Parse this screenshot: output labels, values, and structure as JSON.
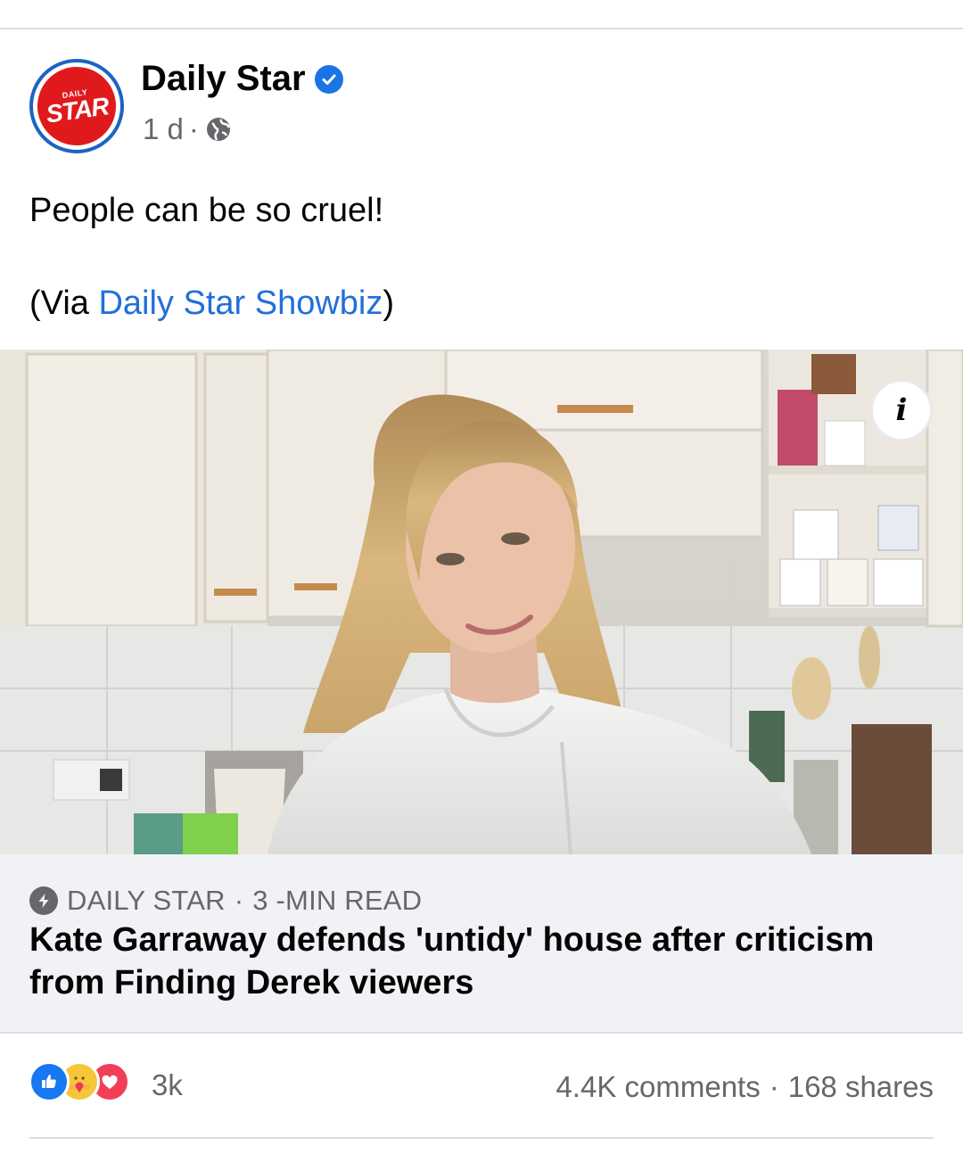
{
  "post": {
    "page_name": "Daily Star",
    "avatar_text_small": "DAILY",
    "avatar_text_big": "STAR",
    "time": "1 d",
    "separator": "·",
    "text_line1": "People can be so cruel!",
    "text_line2_prefix": "(Via ",
    "text_line2_link": "Daily Star Showbiz",
    "text_line2_suffix": ")"
  },
  "link_card": {
    "source": "DAILY STAR",
    "separator": "·",
    "read_time": "3 -MIN READ",
    "title": "Kate Garraway defends 'untidy' house after criticism from Finding Derek viewers",
    "info_label": "i"
  },
  "engagement": {
    "reaction_count": "3k",
    "comments": "4.4K comments",
    "separator": "·",
    "shares": "168 shares",
    "reactions": [
      "like-icon",
      "care-icon",
      "love-icon"
    ]
  },
  "colors": {
    "link_blue": "#216fdb",
    "verified_blue": "#1b74e4",
    "brand_red": "#e0191d",
    "secondary_text": "#65676b",
    "card_bg": "#f0f2f5"
  }
}
